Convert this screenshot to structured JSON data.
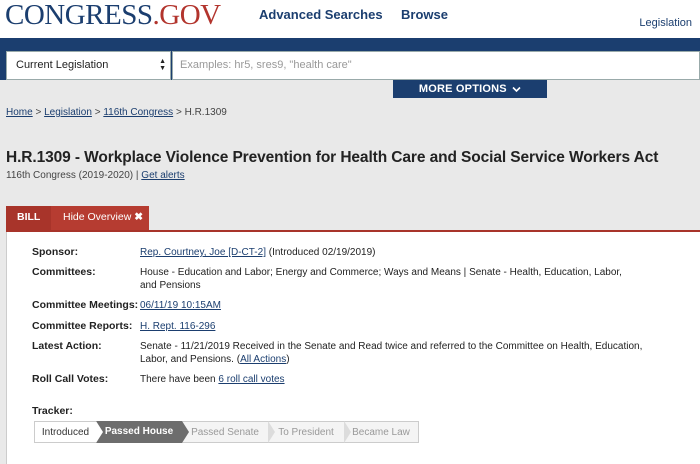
{
  "header": {
    "logo_part1": "CONGRESS",
    "logo_part2": ".GOV",
    "nav_advanced": "Advanced Searches",
    "nav_browse": "Browse",
    "nav_legislation": "Legislation"
  },
  "search": {
    "scope_value": "Current Legislation",
    "placeholder": "Examples: hr5, sres9, \"health care\"",
    "more_options": "MORE OPTIONS",
    "more_options_icon": "chevron-down-icon"
  },
  "breadcrumb": {
    "home": "Home",
    "legislation": "Legislation",
    "congress": "116th Congress",
    "current": "H.R.1309",
    "separator": ">"
  },
  "bill": {
    "title": "H.R.1309 - Workplace Violence Prevention for Health Care and Social Service Workers Act",
    "congress": "116th Congress (2019-2020)",
    "separator": "|",
    "get_alerts": "Get alerts"
  },
  "tabs": {
    "bill": "BILL",
    "hide_overview": "Hide Overview",
    "close_glyph": "✖"
  },
  "overview": {
    "sponsor_label": "Sponsor:",
    "sponsor_link": "Rep. Courtney, Joe [D-CT-2]",
    "sponsor_note": "(Introduced 02/19/2019)",
    "committees_label": "Committees:",
    "committees_value": "House - Education and Labor; Energy and Commerce; Ways and Means | Senate - Health, Education, Labor, and Pensions",
    "meetings_label": "Committee Meetings:",
    "meetings_link": "06/11/19 10:15AM",
    "reports_label": "Committee Reports:",
    "reports_link": "H. Rept. 116-296",
    "latest_label": "Latest Action:",
    "latest_value": "Senate - 11/21/2019 Received in the Senate and Read twice and referred to the Committee on Health, Education, Labor, and Pensions.",
    "all_actions_link": "All Actions",
    "roll_label": "Roll Call Votes:",
    "roll_prefix": "There have been",
    "roll_link": "6 roll call votes",
    "tracker_label": "Tracker:"
  },
  "tracker": {
    "steps": [
      "Introduced",
      "Passed House",
      "Passed Senate",
      "To President",
      "Became Law"
    ],
    "current_step": "Passed House"
  },
  "colors": {
    "navy": "#1b3e6f",
    "brand_red": "#b2342d",
    "tab_red": "#a8342a",
    "tracker_active": "#6d6d6d"
  }
}
